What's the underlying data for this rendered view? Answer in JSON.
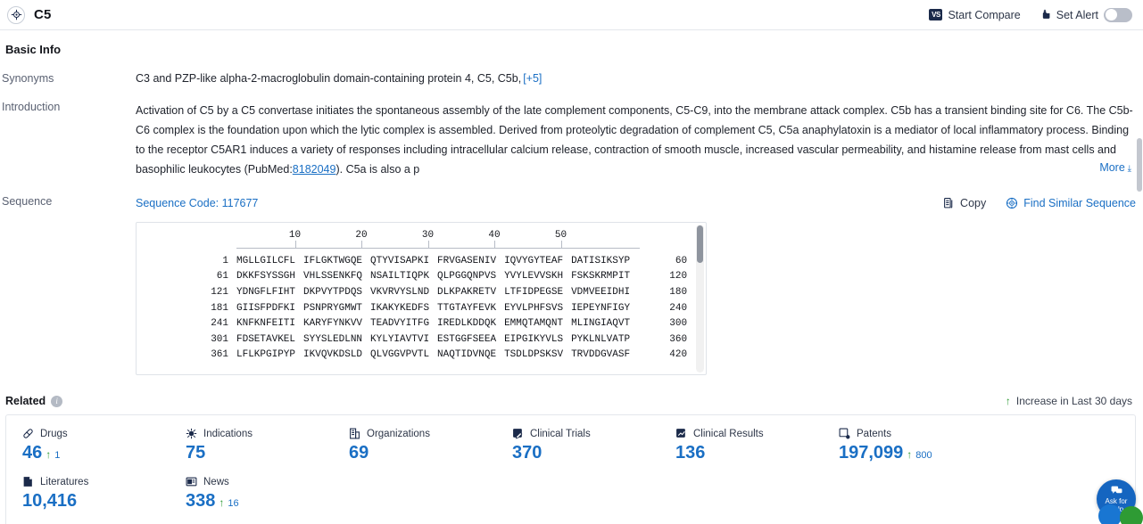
{
  "header": {
    "entity_name": "C5",
    "logo_icon": "target-crosshair-icon",
    "start_compare_label": "Start Compare",
    "start_compare_badge": "VS",
    "set_alert_label": "Set Alert",
    "set_alert_icon": "alert-bell-upload-icon",
    "toggle_state": "off"
  },
  "basic_info": {
    "section_title": "Basic Info",
    "synonyms_label": "Synonyms",
    "synonyms_value": "C3 and PZP-like alpha-2-macroglobulin domain-containing protein 4,  C5,  C5b,",
    "synonyms_more": "[+5]",
    "introduction_label": "Introduction",
    "introduction_part1": "Activation of C5 by a C5 convertase initiates the spontaneous assembly of the late complement components, C5-C9, into the membrane attack complex. C5b has a transient binding site for C6. The C5b-C6 complex is the foundation upon which the lytic complex is assembled. Derived from proteolytic degradation of complement C5, C5a anaphylatoxin is a mediator of local inflammatory process. Binding to the receptor C5AR1 induces a variety of responses including intracellular calcium release, contraction of smooth muscle, increased vascular permeability, and histamine release from mast cells and basophilic leukocytes (PubMed:",
    "pubmed_id": "8182049",
    "introduction_part2": "). C5a is also a p",
    "more_label": "More",
    "more_chevron": "chevron-down-icon"
  },
  "sequence": {
    "row_label": "Sequence",
    "code_label": "Sequence Code: 117677",
    "copy_label": "Copy",
    "copy_icon": "copy-icon",
    "find_similar_label": "Find Similar Sequence",
    "find_similar_icon": "target-crosshair-icon",
    "ruler_ticks": [
      10,
      20,
      30,
      40,
      50
    ],
    "lines": [
      {
        "start": "1",
        "chunks": [
          "MGLLGILCFL",
          "IFLGKTWGQE",
          "QTYVISAPKI",
          "FRVGASENIV",
          "IQVYGYTEAF",
          "DATISIKSYP"
        ],
        "end": "60"
      },
      {
        "start": "61",
        "chunks": [
          "DKKFSYSSGH",
          "VHLSSENKFQ",
          "NSAILTIQPK",
          "QLPGGQNPVS",
          "YVYLEVVSKH",
          "FSKSKRMPIT"
        ],
        "end": "120"
      },
      {
        "start": "121",
        "chunks": [
          "YDNGFLFIHT",
          "DKPVYTPDQS",
          "VKVRVYSLND",
          "DLKPAKRETV",
          "LTFIDPEGSE",
          "VDMVEEIDHI"
        ],
        "end": "180"
      },
      {
        "start": "181",
        "chunks": [
          "GIISFPDFKI",
          "PSNPRYGMWT",
          "IKAKYKEDFS",
          "TTGTAYFEVK",
          "EYVLPHFSVS",
          "IEPEYNFIGY"
        ],
        "end": "240"
      },
      {
        "start": "241",
        "chunks": [
          "KNFKNFEITI",
          "KARYFYNKVV",
          "TEADVYITFG",
          "IREDLKDDQK",
          "EMMQTAMQNT",
          "MLINGIAQVT"
        ],
        "end": "300"
      },
      {
        "start": "301",
        "chunks": [
          "FDSETAVKEL",
          "SYYSLEDLNN",
          "KYLYIAVTVI",
          "ESTGGFSEEA",
          "EIPGIKYVLS",
          "PYKLNLVATP"
        ],
        "end": "360"
      },
      {
        "start": "361",
        "chunks": [
          "LFLKPGIPYP",
          "IKVQVKDSLD",
          "QLVGGVPVTL",
          "NAQTIDVNQE",
          "TSDLDPSKSV",
          "TRVDDGVASF"
        ],
        "end": "420"
      }
    ]
  },
  "related": {
    "title": "Related",
    "info_icon": "info-icon",
    "legend_label": "Increase in Last 30 days",
    "legend_arrow": "up-arrow-icon",
    "stats": [
      {
        "label": "Drugs",
        "icon": "pill-icon",
        "value": "46",
        "delta": "1"
      },
      {
        "label": "Indications",
        "icon": "virus-icon",
        "value": "75",
        "delta": ""
      },
      {
        "label": "Organizations",
        "icon": "building-icon",
        "value": "69",
        "delta": ""
      },
      {
        "label": "Clinical Trials",
        "icon": "clipboard-edit-icon",
        "value": "370",
        "delta": ""
      },
      {
        "label": "Clinical Results",
        "icon": "chart-report-icon",
        "value": "136",
        "delta": ""
      },
      {
        "label": "Patents",
        "icon": "patent-doc-icon",
        "value": "197,099",
        "delta": "800"
      },
      {
        "label": "Literatures",
        "icon": "book-icon",
        "value": "10,416",
        "delta": ""
      },
      {
        "label": "News",
        "icon": "newspaper-icon",
        "value": "338",
        "delta": "16"
      }
    ]
  },
  "help_fab": {
    "line1": "Ask for",
    "line2": "Help",
    "icon": "chat-help-icon"
  },
  "colors": {
    "link_blue": "#1a6fc4",
    "value_blue": "#1a6fc4",
    "increase_green": "#2e9b34",
    "border_gray": "#e4e7ec",
    "fab_blue": "#1565c0"
  }
}
